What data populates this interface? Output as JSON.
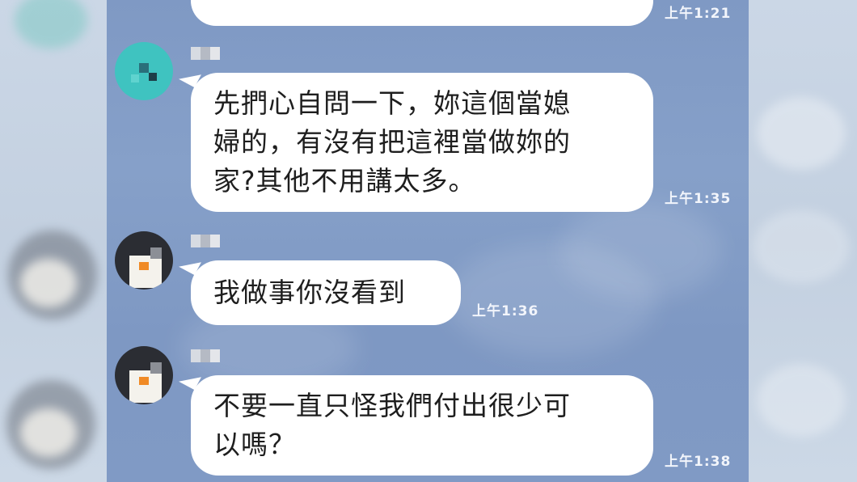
{
  "messages": [
    {
      "text": "",
      "time": "上午1:21"
    },
    {
      "text": "先捫心自問一下，妳這個當媳婦的，有沒有把這裡當做妳的家?其他不用講太多。",
      "line1": "先捫心自問一下，妳這個當媳",
      "line2": "婦的，有沒有把這裡當做妳的",
      "line3": "家?其他不用講太多。",
      "time": "上午1:35"
    },
    {
      "text": "我做事你沒看到",
      "time": "上午1:36"
    },
    {
      "text": "不要一直只怪我們付出很少可以嗎？",
      "line1": "不要一直只怪我們付出很少可",
      "line2": "以嗎？",
      "time": "上午1:38"
    }
  ],
  "colors": {
    "chat_background": "#809ac5",
    "bubble": "#ffffff",
    "timestamp": "#f2f5fb",
    "avatar_teal": "#3fc3c0",
    "avatar_dark": "#2b2d33",
    "avatar_orange": "#f08a25"
  }
}
